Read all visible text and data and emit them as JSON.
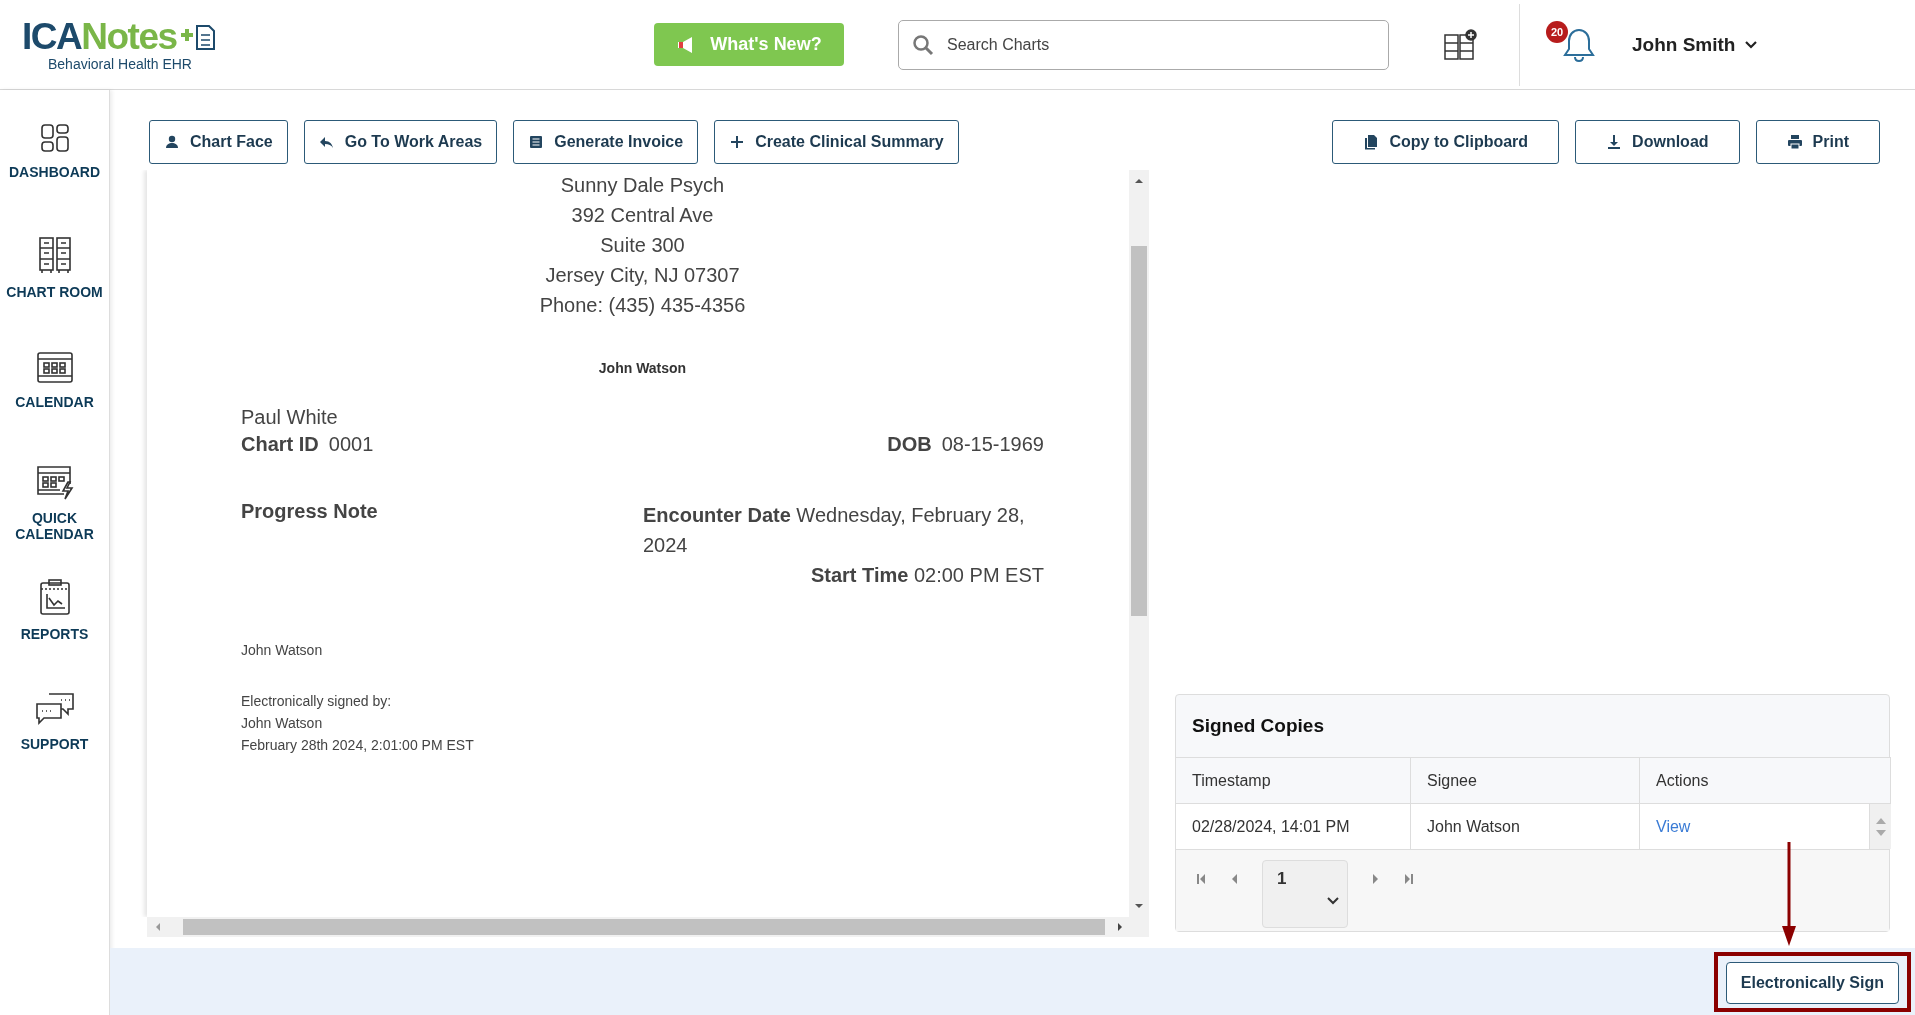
{
  "header": {
    "logo": {
      "brand_first": "ICA",
      "brand_second": "Notes",
      "subtitle": "Behavioral Health EHR"
    },
    "whats_new": "What's New?",
    "search": {
      "placeholder": "Search Charts"
    },
    "notifications": {
      "count": "20"
    },
    "user": "John Smith"
  },
  "sidebar": {
    "items": [
      {
        "label": "DASHBOARD",
        "kind": "dashboard"
      },
      {
        "label": "CHART ROOM",
        "kind": "cabinets"
      },
      {
        "label": "CALENDAR",
        "kind": "calendar"
      },
      {
        "label": "QUICK CALENDAR",
        "kind": "quick-calendar"
      },
      {
        "label": "REPORTS",
        "kind": "reports"
      },
      {
        "label": "SUPPORT",
        "kind": "support"
      }
    ]
  },
  "toolbar": {
    "left": [
      {
        "label": "Chart Face",
        "kind": "person"
      },
      {
        "label": "Go To Work Areas",
        "kind": "reply"
      },
      {
        "label": "Generate Invoice",
        "kind": "list"
      },
      {
        "label": "Create Clinical Summary",
        "kind": "plus"
      }
    ],
    "right": [
      {
        "label": "Copy to Clipboard",
        "kind": "copy"
      },
      {
        "label": "Download",
        "kind": "download"
      },
      {
        "label": "Print",
        "kind": "print"
      }
    ]
  },
  "document": {
    "practice_lines": [
      "Sunny Dale Psych",
      "392 Central Ave",
      "Suite 300",
      "Jersey City, NJ 07307",
      "Phone: (435) 435-4356"
    ],
    "provider": "John Watson",
    "patient": "Paul White",
    "chart_id": {
      "label": "Chart ID",
      "value": "0001"
    },
    "dob": {
      "label": "DOB",
      "value": "08-15-1969"
    },
    "note_type": "Progress Note",
    "encounter_date": "**Encounter Date** Wednesday, February 28, 2024",
    "start_time": "**Start Time** 02:00 PM EST",
    "signature_name": "John Watson",
    "signature_block": [
      "Electronically signed by:",
      "John Watson",
      "February 28th 2024, 2:01:00 PM EST"
    ]
  },
  "signed_copies": {
    "title": "Signed Copies",
    "columns": [
      "Timestamp",
      "Signee",
      "Actions"
    ],
    "rows": [
      {
        "timestamp": "02/28/2024, 14:01 PM",
        "signee": "John Watson",
        "action": "View"
      }
    ],
    "pager": {
      "page": "1"
    }
  },
  "footer": {
    "sign_button": "Electronically Sign"
  }
}
